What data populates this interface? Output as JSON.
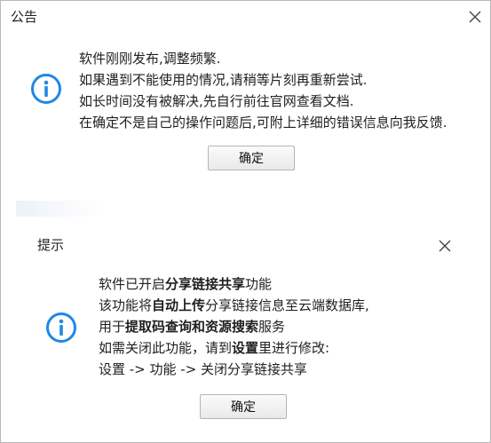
{
  "notice_dialog": {
    "title": "公告",
    "lines": [
      "软件刚刚发布,调整频繁.",
      "如果遇到不能使用的情况,请稍等片刻再重新尝试.",
      "如长时间没有被解决,先自行前往官网查看文档.",
      "在确定不是自己的操作问题后,可附上详细的错误信息向我反馈."
    ],
    "ok_label": "确定",
    "icon": "info-icon",
    "close_icon": "close-icon"
  },
  "tip_dialog": {
    "title": "提示",
    "line1": {
      "pre": "软件已开启",
      "bold": "分享链接共享",
      "post": "功能"
    },
    "line2": {
      "pre": "该功能将",
      "bold": "自动上传",
      "post": "分享链接信息至云端数据库,"
    },
    "line3": {
      "pre": "用于",
      "bold": "提取码查询和资源搜索",
      "post": "服务"
    },
    "line4": {
      "pre": "如需关闭此功能，请到",
      "bold": "设置",
      "post": "里进行修改:"
    },
    "line5": "设置 -> 功能 -> 关闭分享链接共享",
    "ok_label": "确定",
    "icon": "info-icon",
    "close_icon": "close-icon"
  },
  "colors": {
    "accent_blue": "#1e88e5",
    "border": "#b9b9b9"
  }
}
